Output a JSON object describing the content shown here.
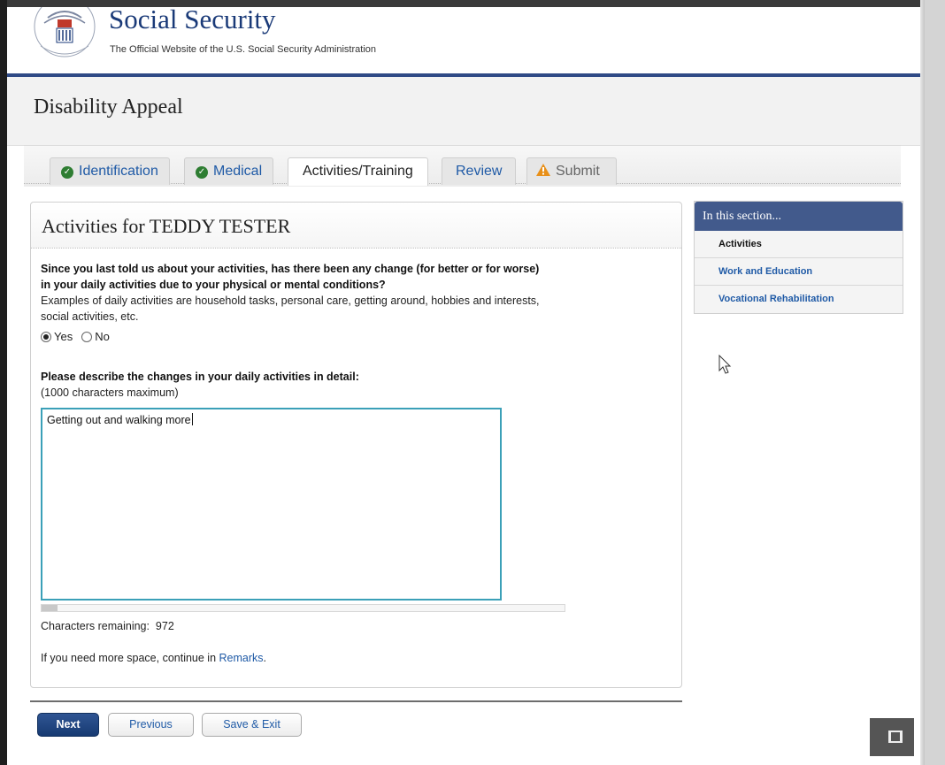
{
  "header": {
    "seal_text": "SOCIAL SECURITY USA ADMINISTRATION",
    "title": "Social Security",
    "subtitle": "The Official Website of the U.S. Social Security Administration"
  },
  "app": {
    "title": "Disability Appeal"
  },
  "tabs": [
    {
      "label": "Identification",
      "state": "complete"
    },
    {
      "label": "Medical",
      "state": "complete"
    },
    {
      "label": "Activities/Training",
      "state": "active"
    },
    {
      "label": "Review",
      "state": "normal"
    },
    {
      "label": "Submit",
      "state": "warning"
    }
  ],
  "form": {
    "title": "Activities for TEDDY TESTER",
    "question_line1": "Since you last told us about your activities, has there been any change (for better or for worse)",
    "question_line2": "in your daily activities due to your physical or mental conditions?",
    "examples_line1": "Examples of daily activities are household tasks, personal care, getting around, hobbies and interests,",
    "examples_line2": "social activities, etc.",
    "yes_label": "Yes",
    "no_label": "No",
    "selected": "Yes",
    "describe_label": "Please describe the changes in your daily activities in detail:",
    "max_hint": "(1000 characters maximum)",
    "textarea_value": "Getting out and walking more",
    "remaining_label": "Characters remaining:",
    "remaining_count": "972",
    "more_space_text": "If you need more space, continue in",
    "remarks_link": "Remarks",
    "remarks_punct": "."
  },
  "sidebar": {
    "heading": "In this section...",
    "items": [
      {
        "label": "Activities",
        "current": true
      },
      {
        "label": "Work and Education",
        "current": false
      },
      {
        "label": "Vocational Rehabilitation",
        "current": false
      }
    ]
  },
  "buttons": {
    "next": "Next",
    "previous": "Previous",
    "save_exit": "Save & Exit"
  },
  "colors": {
    "brand_navy": "#1a3a78",
    "header_rule": "#2f4a86",
    "link_blue": "#1f5aa6",
    "check_green": "#2e7d32",
    "warning_orange": "#e8901a",
    "textarea_focus": "#3ba0b8"
  },
  "icons": {
    "check": "check-circle-icon",
    "warning": "warning-triangle-icon",
    "cursor": "mouse-cursor-icon",
    "fullscreen": "fullscreen-icon"
  }
}
